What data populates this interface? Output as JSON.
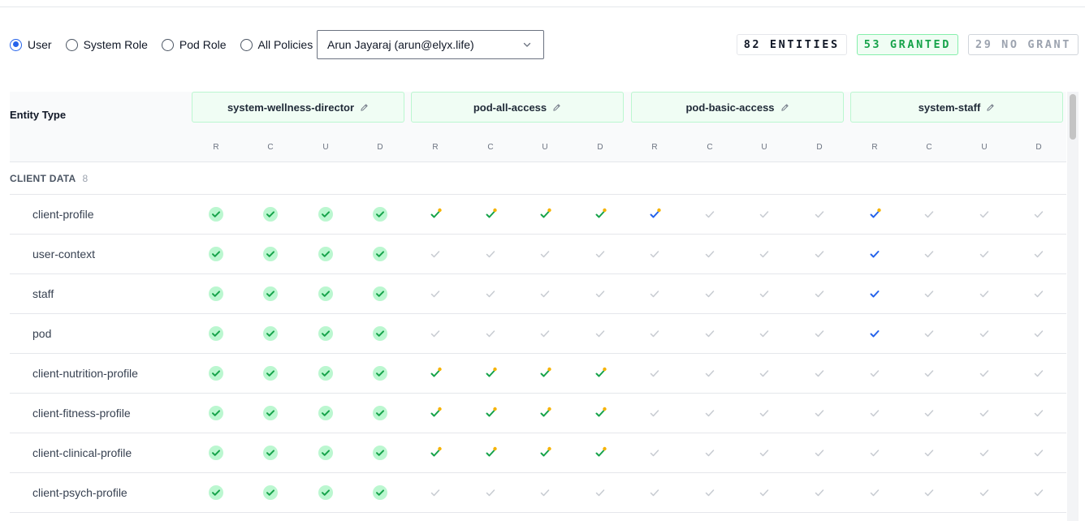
{
  "toolbar": {
    "radios": [
      {
        "label": "User",
        "checked": true
      },
      {
        "label": "System Role",
        "checked": false
      },
      {
        "label": "Pod Role",
        "checked": false
      },
      {
        "label": "All Policies",
        "checked": false
      }
    ],
    "user_select": {
      "value": "Arun Jayaraj (arun@elyx.life)"
    },
    "badges": {
      "entities": "82 ENTITIES",
      "granted": "53 GRANTED",
      "nogrant": "29 NO GRANT"
    }
  },
  "table": {
    "entity_type_label": "Entity Type",
    "operations": [
      "R",
      "C",
      "U",
      "D"
    ],
    "policies": [
      {
        "name": "system-wellness-director"
      },
      {
        "name": "pod-all-access"
      },
      {
        "name": "pod-basic-access"
      },
      {
        "name": "system-staff"
      }
    ],
    "group": {
      "name": "CLIENT DATA",
      "count": "8"
    },
    "rows": [
      {
        "name": "client-profile",
        "cells": [
          "full",
          "full",
          "full",
          "full",
          "greendot",
          "greendot",
          "greendot",
          "greendot",
          "bluedot",
          "none",
          "none",
          "none",
          "bluedot",
          "none",
          "none",
          "none"
        ]
      },
      {
        "name": "user-context",
        "cells": [
          "full",
          "full",
          "full",
          "full",
          "none",
          "none",
          "none",
          "none",
          "none",
          "none",
          "none",
          "none",
          "blue",
          "none",
          "none",
          "none"
        ]
      },
      {
        "name": "staff",
        "cells": [
          "full",
          "full",
          "full",
          "full",
          "none",
          "none",
          "none",
          "none",
          "none",
          "none",
          "none",
          "none",
          "blue",
          "none",
          "none",
          "none"
        ]
      },
      {
        "name": "pod",
        "cells": [
          "full",
          "full",
          "full",
          "full",
          "none",
          "none",
          "none",
          "none",
          "none",
          "none",
          "none",
          "none",
          "blue",
          "none",
          "none",
          "none"
        ]
      },
      {
        "name": "client-nutrition-profile",
        "cells": [
          "full",
          "full",
          "full",
          "full",
          "greendot",
          "greendot",
          "greendot",
          "greendot",
          "none",
          "none",
          "none",
          "none",
          "none",
          "none",
          "none",
          "none"
        ]
      },
      {
        "name": "client-fitness-profile",
        "cells": [
          "full",
          "full",
          "full",
          "full",
          "greendot",
          "greendot",
          "greendot",
          "greendot",
          "none",
          "none",
          "none",
          "none",
          "none",
          "none",
          "none",
          "none"
        ]
      },
      {
        "name": "client-clinical-profile",
        "cells": [
          "full",
          "full",
          "full",
          "full",
          "greendot",
          "greendot",
          "greendot",
          "greendot",
          "none",
          "none",
          "none",
          "none",
          "none",
          "none",
          "none",
          "none"
        ]
      },
      {
        "name": "client-psych-profile",
        "cells": [
          "full",
          "full",
          "full",
          "full",
          "none",
          "none",
          "none",
          "none",
          "none",
          "none",
          "none",
          "none",
          "none",
          "none",
          "none",
          "none"
        ]
      }
    ]
  },
  "colors": {
    "green": "#16a34a",
    "green_circle": "#bbf7d0",
    "blue": "#2563eb",
    "gray": "#c7cbd1",
    "dot": "#f5b301"
  }
}
